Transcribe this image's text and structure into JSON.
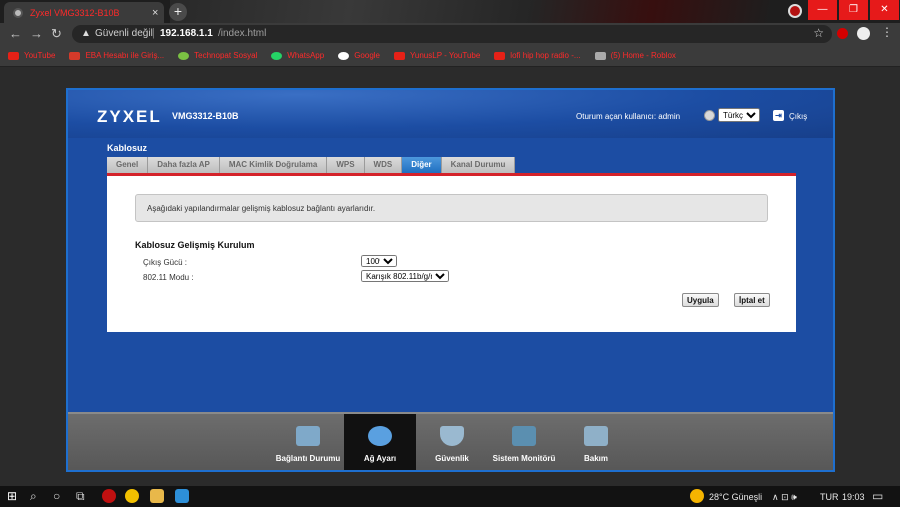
{
  "browser": {
    "tab_title": "Zyxel VMG3312-B10B",
    "tab_close": "×",
    "new_tab": "+",
    "window_controls": [
      "—",
      "❐",
      "✕"
    ],
    "nav": {
      "back": "←",
      "forward": "→",
      "reload": "↻"
    },
    "security_label": "Güvenli değil",
    "url_host": "192.168.1.1",
    "url_path": "/index.html",
    "star": "☆",
    "menu": "⋮",
    "bookmarks": [
      {
        "label": "YouTube",
        "icon_color": "#e62117"
      },
      {
        "label": "EBA Hesabı ile Giriş...",
        "icon_color": "#d43a2a"
      },
      {
        "label": "Technopat Sosyal",
        "icon_color": "#7ac143"
      },
      {
        "label": "WhatsApp",
        "icon_color": "#25d366"
      },
      {
        "label": "Google",
        "icon_color": "#ffffff"
      },
      {
        "label": "YunusLP - YouTube",
        "icon_color": "#e62117"
      },
      {
        "label": "lofi hip hop radio -...",
        "icon_color": "#e62117"
      },
      {
        "label": "(5) Home - Roblox",
        "icon_color": "#aaaaaa"
      }
    ]
  },
  "router": {
    "brand": "ZYXEL",
    "model": "VMG3312-B10B",
    "login_label": "Oturum açan kullanıcı: admin",
    "language": "Türkçe",
    "logout_label": "Çıkış",
    "section_title": "Kablosuz",
    "tabs": [
      {
        "label": "Genel",
        "active": false
      },
      {
        "label": "Daha fazla AP",
        "active": false
      },
      {
        "label": "MAC Kimlik Doğrulama",
        "active": false
      },
      {
        "label": "WPS",
        "active": false
      },
      {
        "label": "WDS",
        "active": false
      },
      {
        "label": "Diğer",
        "active": true
      },
      {
        "label": "Kanal Durumu",
        "active": false
      }
    ],
    "info_text": "Aşağıdaki yapılandırmalar gelişmiş kablosuz bağlantı ayarlarıdır.",
    "form_title": "Kablosuz Gelişmiş Kurulum",
    "fields": {
      "power_label": "Çıkış Gücü :",
      "power_value": "100%",
      "mode_label": "802.11 Modu :",
      "mode_value": "Karışık 802.11b/g/n"
    },
    "apply_label": "Uygula",
    "cancel_label": "İptal et",
    "dock": [
      {
        "label": "Bağlantı Durumu",
        "icon_color": "#7fa9c9",
        "selected": false
      },
      {
        "label": "Ağ Ayarı",
        "icon_color": "#5aa0e0",
        "selected": true
      },
      {
        "label": "Güvenlik",
        "icon_color": "#9ab9d0",
        "selected": false
      },
      {
        "label": "Sistem Monitörü",
        "icon_color": "#5b8fb0",
        "selected": false
      },
      {
        "label": "Bakım",
        "icon_color": "#8fb0c8",
        "selected": false
      }
    ]
  },
  "taskbar": {
    "weather": "28°C  Güneşli",
    "lang": "TUR",
    "time": "19:03",
    "tray_icons": "∧ ⊡ 🕪"
  }
}
